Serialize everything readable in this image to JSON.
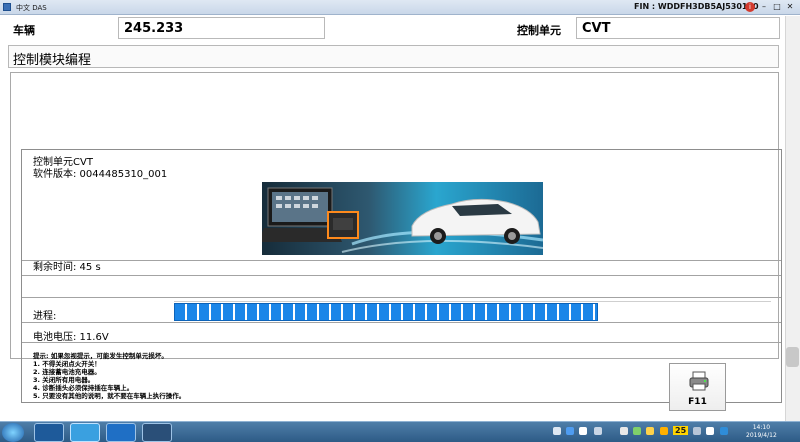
{
  "window": {
    "title": "中文 DAS",
    "fin": "FIN : WDDFH3DB5AJ530160",
    "info_badge": "i",
    "minimize": "–",
    "maximize": "□",
    "close": "✕"
  },
  "header": {
    "vehicle_label": "车辆",
    "vehicle_value": "245.233",
    "control_unit_label": "控制单元",
    "control_unit_value": "CVT"
  },
  "page_title": "控制模块编程",
  "info": {
    "unit_line": "控制单元CVT",
    "software_line": "软件版本: 0044485310_001",
    "remaining_time": "剩余时间: 45 s",
    "progress_label": "进程:",
    "progress_fraction": 0.71,
    "battery_voltage": "电池电压: 11.6V"
  },
  "notes": {
    "header": "提示:   如果忽视提示，可能发生控制单元损坏。",
    "items": [
      "1. 不得关闭点火开关！",
      "2. 连接蓄电池充电器。",
      "3. 关闭所有用电器。",
      "4. 诊断插头必须保持插在车辆上。",
      "5. 只要没有其他的说明，就不要在车辆上执行操作。"
    ]
  },
  "f11_button": {
    "label": "F11",
    "icon": "printer-icon"
  },
  "taskbar": {
    "clock_time": "14:10",
    "clock_date": "2019/4/12",
    "tray_number": "25"
  },
  "colors": {
    "progress_fill": "#1b86e8",
    "taskbar": "#3b6a96",
    "titlebar": "#d4e0ee"
  }
}
